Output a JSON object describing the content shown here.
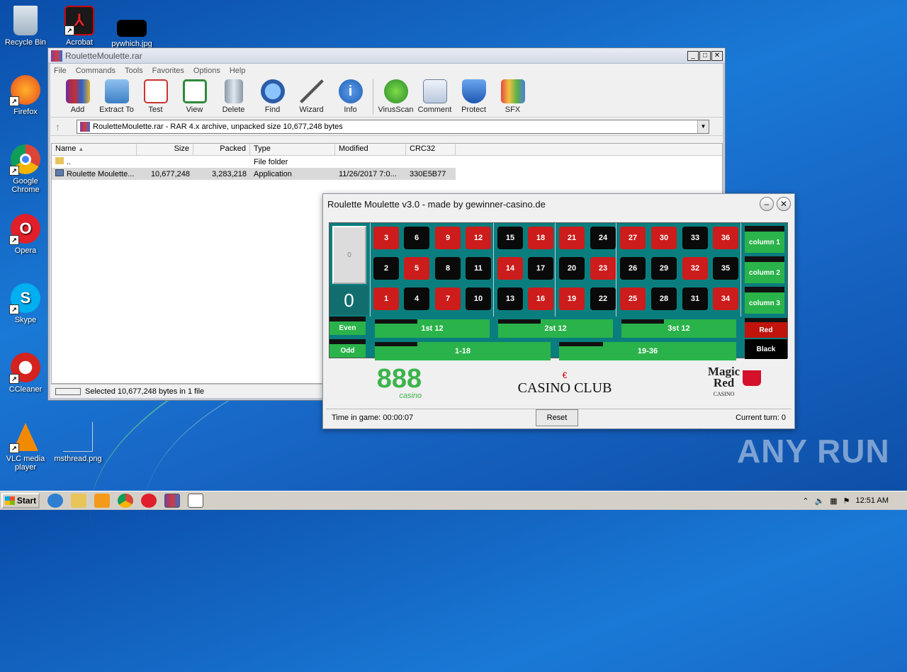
{
  "desktop": {
    "icons": [
      {
        "label": "Recycle Bin",
        "icon": "recycle-bin-icon"
      },
      {
        "label": "Acrobat",
        "icon": "acrobat-icon"
      },
      {
        "label": "pywhich.jpg",
        "icon": "image-icon"
      },
      {
        "label": "Firefox",
        "icon": "firefox-icon"
      },
      {
        "label": "Google Chrome",
        "icon": "chrome-icon"
      },
      {
        "label": "Opera",
        "icon": "opera-icon"
      },
      {
        "label": "Skype",
        "icon": "skype-icon"
      },
      {
        "label": "CCleaner",
        "icon": "ccleaner-icon"
      },
      {
        "label": "VLC media player",
        "icon": "vlc-icon"
      },
      {
        "label": "msthread.png",
        "icon": "image-icon"
      }
    ]
  },
  "winrar": {
    "title": "RouletteMoulette.rar",
    "menu": [
      "File",
      "Commands",
      "Tools",
      "Favorites",
      "Options",
      "Help"
    ],
    "tools": [
      "Add",
      "Extract To",
      "Test",
      "View",
      "Delete",
      "Find",
      "Wizard",
      "Info",
      "VirusScan",
      "Comment",
      "Protect",
      "SFX"
    ],
    "address": "RouletteMoulette.rar - RAR 4.x archive, unpacked size 10,677,248 bytes",
    "columns": [
      "Name",
      "Size",
      "Packed",
      "Type",
      "Modified",
      "CRC32"
    ],
    "rows": [
      {
        "name": "..",
        "size": "",
        "packed": "",
        "type": "File folder",
        "modified": "",
        "crc": ""
      },
      {
        "name": "Roulette Moulette...",
        "size": "10,677,248",
        "packed": "3,283,218",
        "type": "Application",
        "modified": "11/26/2017 7:0...",
        "crc": "330E5B77"
      }
    ],
    "status": "Selected 10,677,248 bytes in 1 file"
  },
  "roulette": {
    "title": "Roulette Moulette v3.0 - made by gewinner-casino.de",
    "zero_button": "0",
    "zero": "0",
    "numbers": {
      "row1": [
        "3",
        "6",
        "9",
        "12",
        "15",
        "18",
        "21",
        "24",
        "27",
        "30",
        "33",
        "36"
      ],
      "row2": [
        "2",
        "5",
        "8",
        "11",
        "14",
        "17",
        "20",
        "23",
        "26",
        "29",
        "32",
        "35"
      ],
      "row3": [
        "1",
        "4",
        "7",
        "10",
        "13",
        "16",
        "19",
        "22",
        "25",
        "28",
        "31",
        "34"
      ]
    },
    "columns": [
      "column 1",
      "column 2",
      "column 3"
    ],
    "dozens": [
      "1st 12",
      "2st 12",
      "3st 12"
    ],
    "halves": [
      "1-18",
      "19-36"
    ],
    "even": "Even",
    "odd": "Odd",
    "red": "Red",
    "black": "Black",
    "logos": {
      "l888": "888",
      "l888sub": "casino",
      "casinoclub": "CASINO CLUB",
      "magic": "Magic",
      "red": "Red",
      "casino": "CASINO"
    },
    "time": "Time in game: 00:00:07",
    "reset": "Reset",
    "turn": "Current turn: 0"
  },
  "taskbar": {
    "start": "Start",
    "clock": "12:51 AM"
  },
  "watermark": "ANY RUN",
  "colors": {
    "red": "#cc1c1c",
    "black": "#0a0a0a",
    "green": "#2ab34a",
    "felt": "#0a7e7e"
  }
}
